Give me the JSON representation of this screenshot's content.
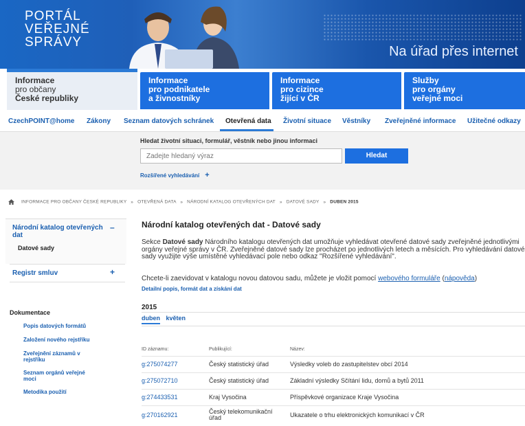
{
  "banner": {
    "logo_lines": [
      "PORTÁL",
      "VEŘEJNÉ",
      "SPRÁVY"
    ],
    "slogan": "Na úřad přes internet"
  },
  "tabs": [
    {
      "lines": [
        "Informace",
        "pro občany",
        "České republiky"
      ]
    },
    {
      "lines": [
        "Informace",
        "pro podnikatele",
        "a živnostníky"
      ]
    },
    {
      "lines": [
        "Informace",
        "pro cizince",
        "žijící v ČR"
      ]
    },
    {
      "lines": [
        "Služby",
        "pro orgány",
        "veřejné moci"
      ]
    }
  ],
  "topnav": [
    "CzechPOINT@home",
    "Zákony",
    "Seznam datových schránek",
    "Otevřená data",
    "Životní situace",
    "Věstníky",
    "Zveřejněné informace",
    "Užitečné odkazy"
  ],
  "search": {
    "label": "Hledat životní situaci, formulář, věstník nebo jinou informaci",
    "placeholder": "Zadejte hledaný výraz",
    "button": "Hledat",
    "advanced": "Rozšířené vyhledávání",
    "advanced_plus": "+"
  },
  "breadcrumb": [
    "INFORMACE PRO OBČANY ČESKÉ REPUBLIKY",
    "OTEVŘENÁ DATA",
    "NÁRODNÍ KATALOG OTEVŘENÝCH DAT",
    "DATOVÉ SADY",
    "DUBEN 2015"
  ],
  "breadcrumb_sep": "»",
  "sidebar": {
    "catalog_lines": [
      "Národní katalog otevřených",
      "dat"
    ],
    "catalog_toggle": "–",
    "datasets": "Datové sady",
    "registry": "Registr smluv",
    "registry_toggle": "+",
    "docs_title": "Dokumentace",
    "docs": [
      {
        "lines": [
          "Popis datových formátů"
        ]
      },
      {
        "lines": [
          "Založení nového rejstříku"
        ]
      },
      {
        "lines": [
          "Zveřejnění záznamů v",
          "rejstříku"
        ]
      },
      {
        "lines": [
          "Seznam orgánů veřejné",
          "moci"
        ]
      },
      {
        "lines": [
          "Metodika použití"
        ]
      }
    ]
  },
  "main": {
    "title": "Národní katalog otevřených dat - Datové sady",
    "p1_prefix": "Sekce ",
    "p1_bold": "Datové sady",
    "p1_rest": " Národního katalogu otevřených dat umožňuje vyhledávat otevřené datové sady zveřejněné jednotlivými orgány veřejné správy v ČR. Zveřejněné datové sady lze procházet po jednotlivých letech a měsících. Pro vyhledávání datové sady využijte výše umístěné vyhledávací pole nebo odkaz \"Rozšířené vyhledávání\".",
    "p2_prefix": "Chcete-li zaevidovat v katalogu novou datovou sadu, můžete je vložit pomocí ",
    "p2_link1": "webového formuláře",
    "p2_mid": " (",
    "p2_link2": "nápověda",
    "p2_end": ")",
    "detail_link": "Detailní popis, formát dat a získání dat",
    "year": "2015",
    "months": [
      "duben",
      "květen"
    ],
    "table": {
      "headers": [
        "ID záznamu:",
        "Publikující:",
        "Název:"
      ],
      "rows": [
        {
          "id": "g:275074277",
          "publisher": [
            "Český statistický úřad"
          ],
          "name": "Výsledky voleb do zastupitelstev obcí 2014"
        },
        {
          "id": "g:275072710",
          "publisher": [
            "Český statistický úřad"
          ],
          "name": "Základní výsledky Sčítání lidu, domů a bytů 2011"
        },
        {
          "id": "g:274433531",
          "publisher": [
            "Kraj Vysočina"
          ],
          "name": "Příspěvkové organizace Kraje Vysočina"
        },
        {
          "id": "g:270162921",
          "publisher": [
            "Český telekomunikační",
            "úřad"
          ],
          "name": "Ukazatele o trhu elektronických komunikací v ČR"
        }
      ]
    }
  },
  "colors": {
    "brand_blue": "#1d6fe0",
    "link": "#1a5fb0",
    "banner_dark": "#0d3f8e"
  }
}
